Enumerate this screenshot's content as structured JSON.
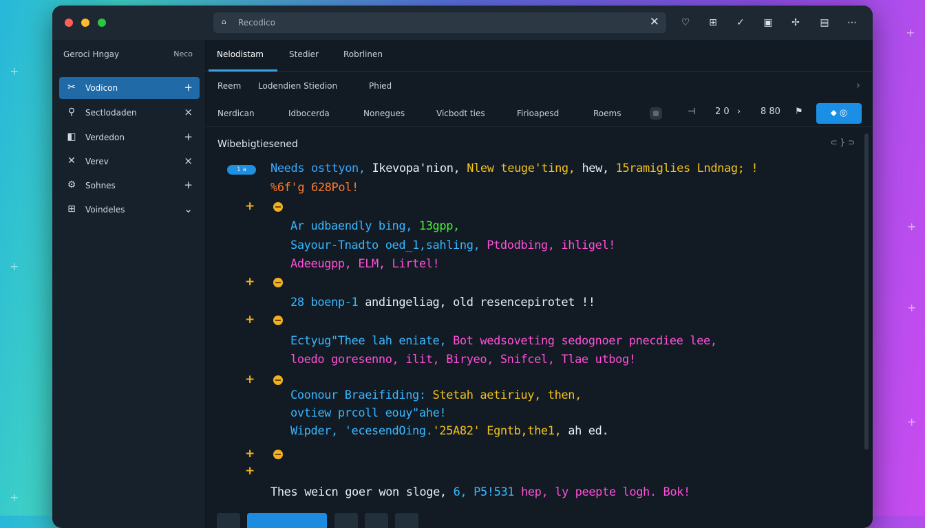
{
  "window": {
    "address_text": "Recodico",
    "traffic_colors": [
      "#ff5f57",
      "#febc2e",
      "#28c840"
    ]
  },
  "toolbar": {
    "icons": [
      "shield-icon",
      "book-icon",
      "check-icon",
      "image-icon",
      "pin-icon",
      "document-icon",
      "more-icon"
    ]
  },
  "sidebar": {
    "title": "Geroci Hngay",
    "new_label": "Neco",
    "items": [
      {
        "label": "Vodicon",
        "icon": "scissors-icon",
        "action": "+"
      },
      {
        "label": "Sectlodaden",
        "icon": "stamp-icon",
        "action": "×"
      },
      {
        "label": "Verdedon",
        "icon": "panel-icon",
        "action": "+"
      },
      {
        "label": "Verev",
        "icon": "cross-icon",
        "action": "×"
      },
      {
        "label": "Sohnes",
        "icon": "gear-icon",
        "action": "+"
      },
      {
        "label": "Voindeles",
        "icon": "grid-icon",
        "action": "⌄"
      }
    ]
  },
  "tabs": [
    {
      "label": "Nelodistam"
    },
    {
      "label": "Stedier"
    },
    {
      "label": "Robrlinen"
    }
  ],
  "subbar": {
    "items": [
      "Reem",
      "Lodendien Stiedion",
      "Phied"
    ]
  },
  "menubar": {
    "items": [
      "Nerdican",
      "Idbocerda",
      "Nonegues",
      "Vicbodt ties",
      "Firioapesd",
      "Roems"
    ],
    "zoom": "2 0",
    "count": "8 80",
    "run_label": "⬥ ◎"
  },
  "content": {
    "heading": "Wibebigtiesened",
    "badge": "1 a",
    "ctrl": "⊂ } ⊃",
    "lines": [
      {
        "segments": [
          {
            "text": "Needs ",
            "color": "#3aa8ff"
          },
          {
            "text": "osttyon, ",
            "color": "#3aa8ff"
          },
          {
            "text": "Ikevopa'nion, ",
            "color": "#e6edf5"
          },
          {
            "text": "Nlew teuge'ting, ",
            "color": "#f4c21a"
          },
          {
            "text": "hew, ",
            "color": "#e6edf5"
          },
          {
            "text": "15ramiglies ",
            "color": "#f4c21a"
          },
          {
            "text": "Lndnag; !",
            "color": "#f4c21a"
          }
        ]
      },
      {
        "segments": [
          {
            "text": "%6f'g 628Pol!",
            "color": "#ff7a2e"
          }
        ]
      },
      {
        "segments": [
          {
            "text": "Ar ",
            "color": "#38b6ff"
          },
          {
            "text": "udbaendly bing, ",
            "color": "#38b6ff"
          },
          {
            "text": "13gpp,",
            "color": "#4ef03c"
          }
        ]
      },
      {
        "segments": [
          {
            "text": "Sayour-Tnadto ",
            "color": "#38b6ff"
          },
          {
            "text": "oed_1,sahling, ",
            "color": "#38b6ff"
          },
          {
            "text": "Ptdodbing, ",
            "color": "#ff4fd8"
          },
          {
            "text": "ihligel!",
            "color": "#ff4fd8"
          }
        ]
      },
      {
        "segments": [
          {
            "text": "Adeeugpp, ",
            "color": "#ff4fd8"
          },
          {
            "text": "ELM, ",
            "color": "#ff4fd8"
          },
          {
            "text": "Lirtel!",
            "color": "#ff4fd8"
          }
        ]
      },
      {
        "segments": [
          {
            "text": "28 ",
            "color": "#38b6ff"
          },
          {
            "text": "boenp-1 ",
            "color": "#38b6ff"
          },
          {
            "text": "andingeliag, ",
            "color": "#e6edf5"
          },
          {
            "text": "old ",
            "color": "#e6edf5"
          },
          {
            "text": "resencepirotet !!",
            "color": "#e6edf5"
          }
        ]
      },
      {
        "segments": [
          {
            "text": "Ectyug\"Thee ",
            "color": "#38b6ff"
          },
          {
            "text": "lah ",
            "color": "#38b6ff"
          },
          {
            "text": "eniate, ",
            "color": "#38b6ff"
          },
          {
            "text": "Bot ",
            "color": "#ff4fd8"
          },
          {
            "text": "wedsoveting ",
            "color": "#ff4fd8"
          },
          {
            "text": "sedognoer ",
            "color": "#ff4fd8"
          },
          {
            "text": "pnecdiee ",
            "color": "#ff4fd8"
          },
          {
            "text": "lee,",
            "color": "#ff4fd8"
          }
        ]
      },
      {
        "segments": [
          {
            "text": "loedo ",
            "color": "#ff4fd8"
          },
          {
            "text": "goresenno, ",
            "color": "#ff4fd8"
          },
          {
            "text": "ilit, ",
            "color": "#ff4fd8"
          },
          {
            "text": "Biryeo, ",
            "color": "#ff4fd8"
          },
          {
            "text": "Snifcel, ",
            "color": "#ff4fd8"
          },
          {
            "text": "Tlae ",
            "color": "#ff4fd8"
          },
          {
            "text": "utbog!",
            "color": "#ff4fd8"
          }
        ]
      },
      {
        "segments": [
          {
            "text": "Coonour ",
            "color": "#38b6ff"
          },
          {
            "text": "Braeifiding: ",
            "color": "#38b6ff"
          },
          {
            "text": "Stetah ",
            "color": "#f4c21a"
          },
          {
            "text": "aetiriuy, ",
            "color": "#f4c21a"
          },
          {
            "text": "then,",
            "color": "#f4c21a"
          }
        ]
      },
      {
        "segments": [
          {
            "text": "ovtiew ",
            "color": "#38b6ff"
          },
          {
            "text": "prcoll ",
            "color": "#38b6ff"
          },
          {
            "text": "eouy\"ahe!",
            "color": "#38b6ff"
          }
        ]
      },
      {
        "segments": [
          {
            "text": "Wipder, ",
            "color": "#38b6ff"
          },
          {
            "text": "'ecesendOing.",
            "color": "#38b6ff"
          },
          {
            "text": "'25A82' ",
            "color": "#f4c21a"
          },
          {
            "text": "Egntb,the1, ",
            "color": "#f4c21a"
          },
          {
            "text": "ah ",
            "color": "#e6edf5"
          },
          {
            "text": "ed.",
            "color": "#e6edf5"
          }
        ]
      },
      {
        "segments": [
          {
            "text": "Thes ",
            "color": "#e6edf5"
          },
          {
            "text": "weicn ",
            "color": "#e6edf5"
          },
          {
            "text": "goer ",
            "color": "#e6edf5"
          },
          {
            "text": "won ",
            "color": "#e6edf5"
          },
          {
            "text": "sloge, ",
            "color": "#e6edf5"
          },
          {
            "text": "6, ",
            "color": "#38b6ff"
          },
          {
            "text": "P5!531 ",
            "color": "#38b6ff"
          },
          {
            "text": "hep, ",
            "color": "#ff4fd8"
          },
          {
            "text": "ly ",
            "color": "#ff4fd8"
          },
          {
            "text": "peepte ",
            "color": "#ff4fd8"
          },
          {
            "text": "logh. ",
            "color": "#ff4fd8"
          },
          {
            "text": "Bok!",
            "color": "#ff4fd8"
          }
        ]
      }
    ]
  },
  "colors": {
    "accent": "#1b8fe6",
    "sidebar_active": "#1f6aa7",
    "gutter_marker": "#f2b020"
  }
}
